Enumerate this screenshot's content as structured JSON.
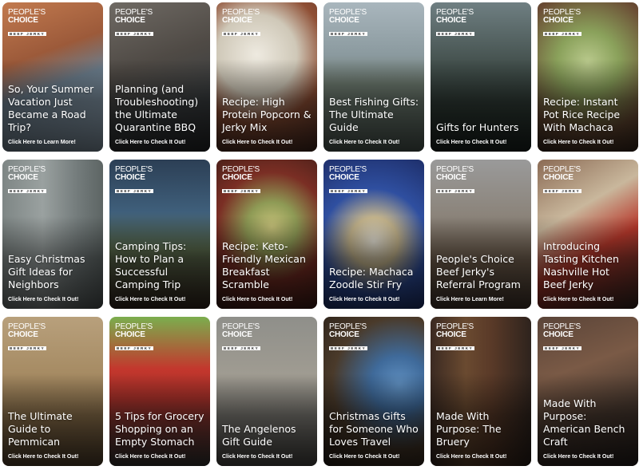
{
  "logo": {
    "line1": "PEOPLE'S",
    "line2": "CHOICE",
    "line3": "BEEF JERKY"
  },
  "cards": [
    {
      "title": "So, Your Summer Vacation Just Became a Road Trip?",
      "cta": "Click Here to Learn More!",
      "bg": "linear-gradient(160deg,#c27a4f 0%,#9c5a3a 35%,#6b7d8c 55%,#9eb3c4 100%)"
    },
    {
      "title": "Planning (and Troubleshooting) the Ultimate Quarantine BBQ",
      "cta": "Click Here to Check It Out!",
      "bg": "linear-gradient(160deg,#6f6a64 0%,#4f4a45 40%,#3a3e40 70%,#2b2c2e 100%)"
    },
    {
      "title": "Recipe: High Protein Popcorn & Jerky Mix",
      "cta": "Click Here to Check It Out!",
      "bg": "radial-gradient(circle at 40% 35%,#eeeae0 0%,#cfc8b8 35%,#8f4f35 60%,#4a2c22 100%)"
    },
    {
      "title": "Best Fishing Gifts: The Ultimate Guide",
      "cta": "Click Here to Check It Out!",
      "bg": "linear-gradient(180deg,#a9b6bd 0%,#8b9a9f 35%,#6d7a6f 55%,#5b6a62 100%)"
    },
    {
      "title": "Gifts for Hunters",
      "cta": "Click Here to Check It Out!",
      "bg": "linear-gradient(180deg,#6f7f82 0%,#45524f 40%,#2e3a34 70%,#1f2824 100%)"
    },
    {
      "title": "Recipe: Instant Pot Rice Recipe With Machaca",
      "cta": "Click Here to Check It Out!",
      "bg": "radial-gradient(circle at 50% 40%,#b9c98c 0%,#8aa15b 30%,#6a4b34 70%,#3e2b1f 100%)"
    },
    {
      "title": "Easy Christmas Gift Ideas for Neighbors",
      "cta": "Click Here to Check It Out!",
      "bg": "linear-gradient(90deg,#7e8685 0%,#9aa1a0 40%,#737b7b 75%,#5d6564 100%)"
    },
    {
      "title": "Camping Tips: How to Plan a Successful Camping Trip",
      "cta": "Click Here to Check It Out!",
      "bg": "linear-gradient(180deg,#2c3f55 0%,#3f5f7b 35%,#5a6b4d 60%,#3a2c22 100%)"
    },
    {
      "title": "Recipe: Keto-Friendly Mexican Breakfast Scramble",
      "cta": "Click Here to Check It Out!",
      "bg": "radial-gradient(circle at 55% 45%,#c7c27a 0%,#8e9a55 25%,#7a2e24 55%,#3c1c16 100%)"
    },
    {
      "title": "Recipe: Machaca Zoodle Stir Fry",
      "cta": "Click Here to Check It Out!",
      "bg": "radial-gradient(circle at 50% 55%,#e6e2d6 0%,#c4b48c 25%,#2f4fa0 55%,#1e2f6b 100%)"
    },
    {
      "title": "People's Choice Beef Jerky's Referral Program",
      "cta": "Click Here to Learn More!",
      "bg": "linear-gradient(180deg,#9a9a9a 0%,#8a8278 40%,#6d5b4a 70%,#4d3e33 100%)"
    },
    {
      "title": "Introducing Tasting Kitchen Nashville Hot Beef Jerky",
      "cta": "Click Here to Check It Out!",
      "bg": "linear-gradient(150deg,#8b6b55 0%,#c9b79c 35%,#b8392c 60%,#3b2a25 100%)"
    },
    {
      "title": "The Ultimate Guide to Pemmican",
      "cta": "Click Here to Check It Out!",
      "bg": "linear-gradient(180deg,#b8a07c 0%,#a58a62 40%,#8a6f4a 70%,#5e4a33 100%)"
    },
    {
      "title": "5 Tips for Grocery Shopping on an Empty Stomach",
      "cta": "Click Here to Check It Out!",
      "bg": "linear-gradient(180deg,#7bae4e 0%,#c3372d 35%,#a8312a 55%,#3c3b39 100%)"
    },
    {
      "title": "The Angelenos Gift Guide",
      "cta": "Click Here to Check It Out!",
      "bg": "linear-gradient(180deg,#8f8f8a 0%,#a09c92 40%,#7c7a74 70%,#55534f 100%)"
    },
    {
      "title": "Christmas Gifts for Someone Who Loves Travel",
      "cta": "Click Here to Check It Out!",
      "bg": "radial-gradient(circle at 75% 45%,#5f8fc0 0%,#3f6a9a 25%,#4a3a2a 60%,#2a2018 100%)"
    },
    {
      "title": "Made With Purpose: The Bruery",
      "cta": "Click Here to Check It Out!",
      "bg": "linear-gradient(90deg,#3b2a22 0%,#6a4a30 35%,#5a3a28 60%,#2e231d 100%)"
    },
    {
      "title": "Made With Purpose: American Bench Craft",
      "cta": "Click Here to Check It Out!",
      "bg": "linear-gradient(160deg,#5a4438 0%,#7a5a46 35%,#4a3a30 65%,#2a2220 100%)"
    }
  ]
}
